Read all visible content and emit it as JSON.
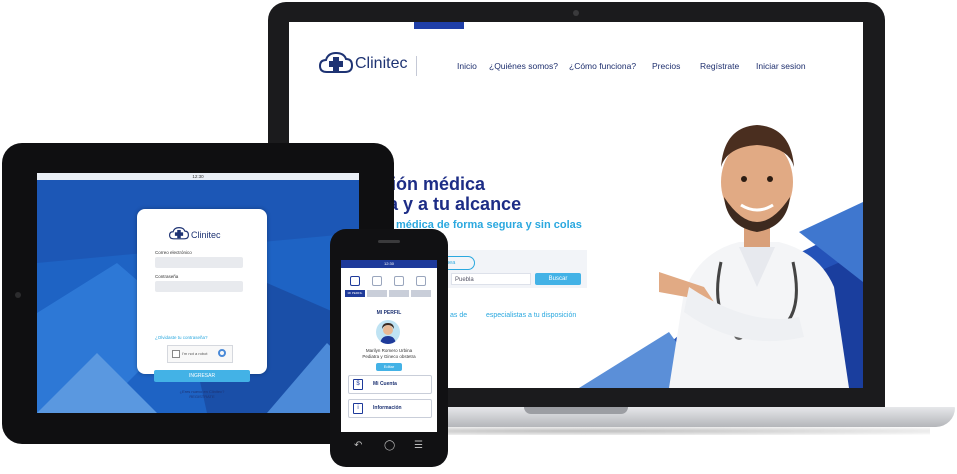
{
  "laptop": {
    "brand": "Clinitec",
    "nav": [
      "Inicio",
      "¿Quiénes somos?",
      "¿Cómo funciona?",
      "Precios",
      "Regístrate",
      "Iniciar sesion"
    ],
    "hero_line1": "ción médica",
    "hero_line2": "ra y a tu alcance",
    "hero_sub": "médica de forma segura y sin colas",
    "search_pill": "a línea",
    "search_select": "Puebla",
    "search_button": "Buscar",
    "stat_a": "as de",
    "stat_b": "especialistas a tu disposición",
    "colors": {
      "navy": "#1d2d86",
      "accent": "#2aa8df",
      "button": "#43b2e6"
    }
  },
  "tablet": {
    "status_time": "12:30",
    "brand": "Clinitec",
    "email_label": "Correo electrónico",
    "password_label": "Contraseña",
    "forgot": "¿Olvidaste tu contraseña?",
    "captcha_label": "I'm not a robot",
    "submit": "INGRESAR",
    "register_prompt": "¿Eres nuevo en Clinitec?",
    "register_link": "REGISTRATE"
  },
  "phone": {
    "status_time": "12:30",
    "tabs": [
      "MI PERFIL",
      "",
      "",
      ""
    ],
    "title": "MI PERFIL",
    "name": "Marilyn Romero Urbina",
    "role": "Pediatra y Gineco obstetra",
    "edit": "Editar",
    "items": [
      {
        "icon": "$",
        "label": "Mi Cuenta"
      },
      {
        "icon": "i",
        "label": "Información"
      }
    ]
  }
}
